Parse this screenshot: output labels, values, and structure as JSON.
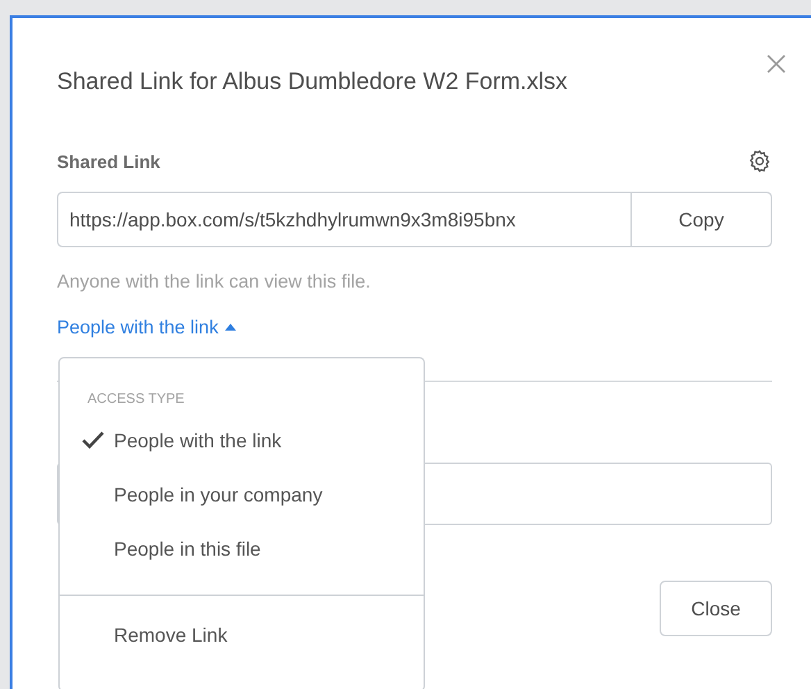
{
  "dialog": {
    "title": "Shared Link for Albus Dumbledore W2 Form.xlsx",
    "shared_link": {
      "label": "Shared Link",
      "url": "https://app.box.com/s/t5kzhdhylrumwn9x3m8i95bnx",
      "copy_button": "Copy"
    },
    "note": "Anyone with the link can view this file.",
    "access_link": {
      "label": "People with the link",
      "expanded": true
    },
    "close_button": "Close"
  },
  "access_menu": {
    "heading": "ACCESS TYPE",
    "options": [
      {
        "label": "People with the link",
        "selected": true
      },
      {
        "label": "People in your company",
        "selected": false
      },
      {
        "label": "People in this file",
        "selected": false
      }
    ],
    "remove_link": "Remove Link"
  }
}
